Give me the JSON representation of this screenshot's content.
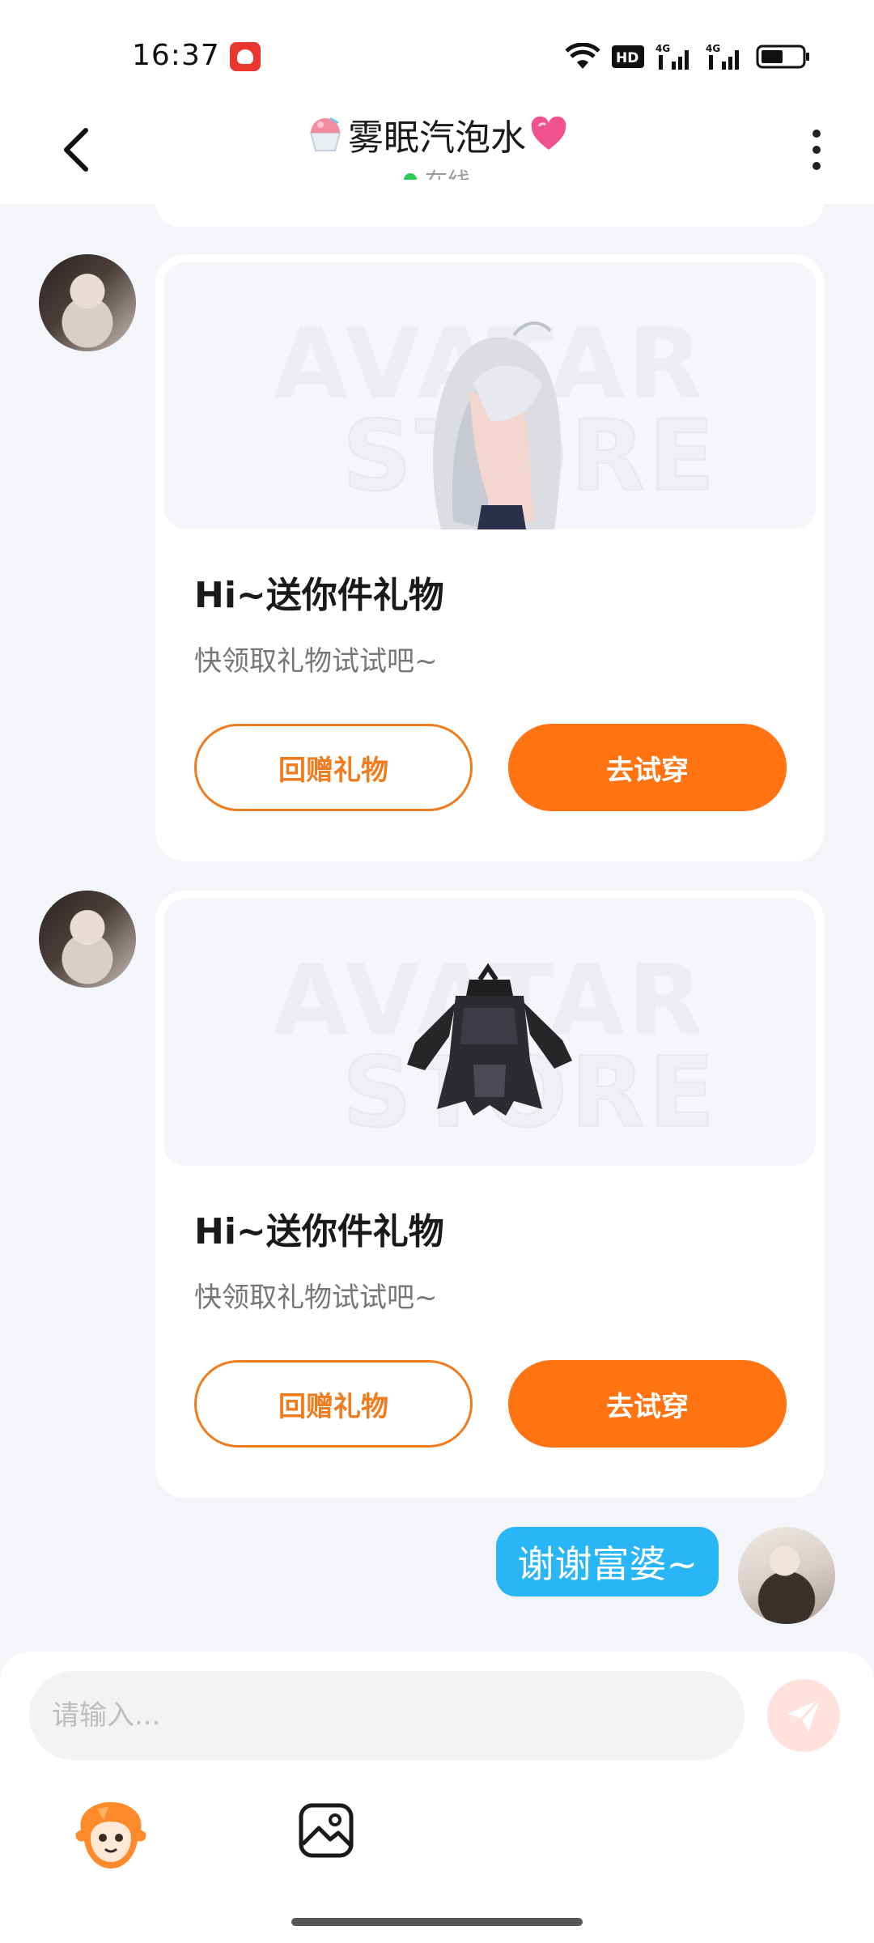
{
  "status_bar": {
    "time": "16:37",
    "icons": [
      "app-notification-icon",
      "wifi-icon",
      "hd-icon",
      "4g-signal-icon",
      "4g-signal-icon",
      "battery-icon"
    ]
  },
  "header": {
    "title": "雾眠汽泡水",
    "status": "在线",
    "title_icons": [
      "shaved-ice-icon",
      "heart-icon"
    ]
  },
  "messages": [
    {
      "type": "gift",
      "watermark_line1": "AVATAR",
      "watermark_line2": "STORE",
      "title": "Hi~送你件礼物",
      "subtitle": "快领取礼物试试吧~",
      "return_label": "回赠礼物",
      "try_label": "去试穿"
    },
    {
      "type": "gift",
      "watermark_line1": "AVATAR",
      "watermark_line2": "STORE",
      "title": "Hi~送你件礼物",
      "subtitle": "快领取礼物试试吧~",
      "return_label": "回赠礼物",
      "try_label": "去试穿"
    },
    {
      "type": "text",
      "text": "谢谢富婆~"
    }
  ],
  "input": {
    "placeholder": "请输入..."
  },
  "colors": {
    "accent_orange": "#ff7411",
    "bubble_blue": "#29b6f6",
    "online_green": "#2ccd55"
  }
}
